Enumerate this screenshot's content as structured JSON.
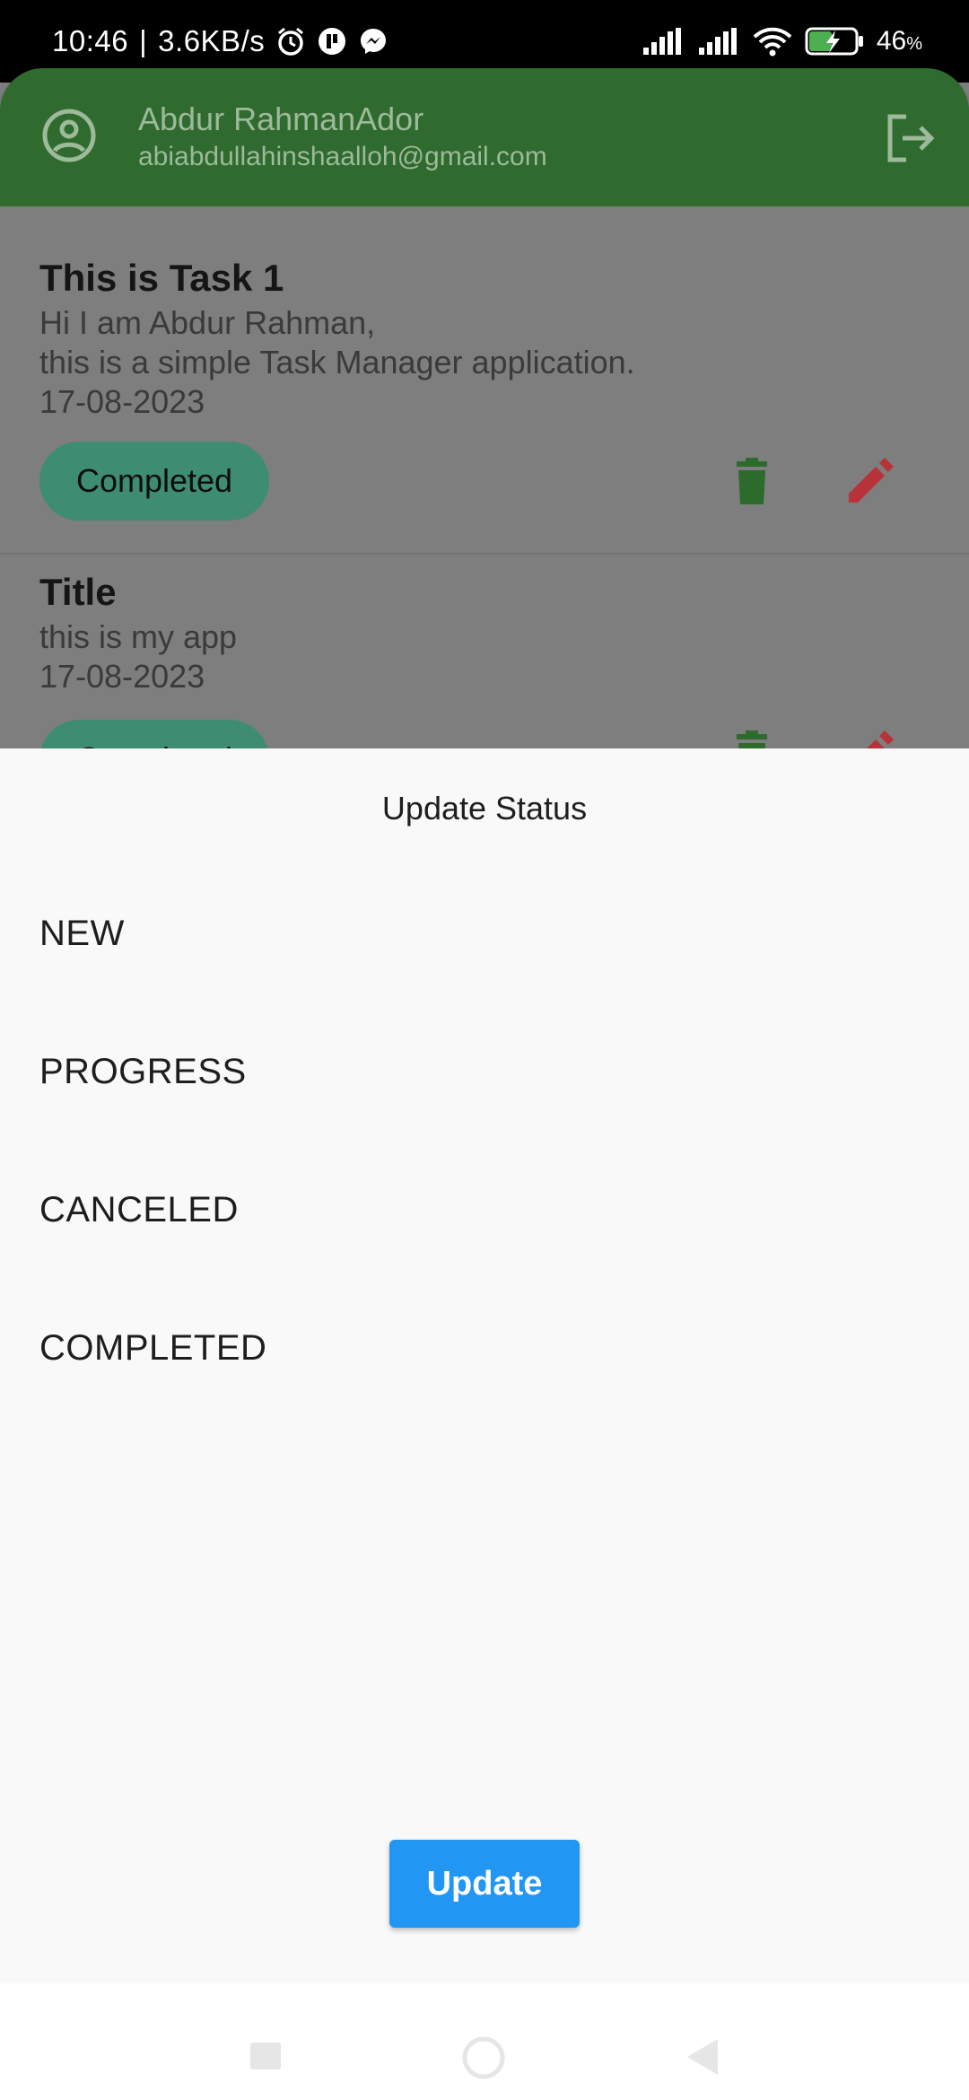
{
  "status_bar": {
    "time": "10:46",
    "network_speed": "3.6KB/s",
    "battery_percent": "46",
    "battery_unit": "%",
    "icons": [
      "alarm-icon",
      "app-notification-icon",
      "messenger-icon",
      "signal-icon",
      "signal-icon",
      "wifi-icon",
      "battery-charging-icon"
    ]
  },
  "app_bar": {
    "user_name": "Abdur RahmanAdor",
    "user_email": "abiabdullahinshaalloh@gmail.com",
    "avatar_icon": "account-circle-icon",
    "logout_icon": "logout-icon"
  },
  "tasks": [
    {
      "title": "This is Task 1",
      "description_line1": "Hi I am Abdur Rahman,",
      "description_line2": "this is a simple Task Manager application.",
      "date": "17-08-2023",
      "status": "Completed"
    },
    {
      "title": "Title",
      "description_line1": "this is my app",
      "date": "17-08-2023",
      "status": "Completed"
    }
  ],
  "sheet": {
    "title": "Update Status",
    "options": [
      "NEW",
      "PROGRESS",
      "CANCELED",
      "COMPLETED"
    ],
    "update_label": "Update"
  },
  "colors": {
    "app_bar": "#2f6a2e",
    "chip": "#3e8d73",
    "delete_icon": "#2c6b2c",
    "edit_icon": "#b8323a",
    "update_button": "#2196f3",
    "sheet_bg": "#f9f9f9"
  }
}
